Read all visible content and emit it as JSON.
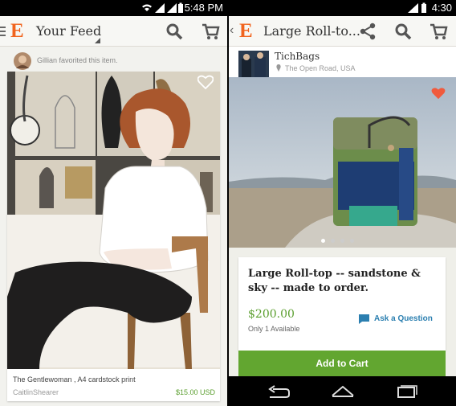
{
  "left": {
    "time": "5:48 PM",
    "title": "Your Feed",
    "activity": "Gillian favorited this item.",
    "item": {
      "title": "The Gentlewoman , A4 cardstock print",
      "shop": "CaitlinShearer",
      "price": "$15.00 USD"
    }
  },
  "right": {
    "time": "4:30",
    "title": "Large Roll-to...",
    "shop": {
      "name": "TichBags",
      "location": "The Open Road, USA"
    },
    "item": {
      "title": "Large Roll-top -- sandstone & sky -- made to order.",
      "price": "$200.00",
      "availability": "Only 1 Available"
    },
    "ask_label": "Ask a Question",
    "cart_label": "Add to Cart",
    "carousel": {
      "count": 4,
      "active": 1
    }
  },
  "colors": {
    "etsy_orange": "#f1641e",
    "price_green": "#5a9e2e",
    "link_blue": "#2b7fb0",
    "cart_button": "#62a630",
    "heart": "#f05a3d"
  },
  "icons": [
    "hamburger-icon",
    "etsy-logo-icon",
    "search-icon",
    "cart-icon",
    "share-icon",
    "back-chevron-icon",
    "heart-icon",
    "location-pin-icon",
    "speech-bubble-icon",
    "back-nav-icon",
    "home-nav-icon",
    "recents-nav-icon",
    "wifi-icon",
    "signal-icon",
    "battery-icon"
  ]
}
